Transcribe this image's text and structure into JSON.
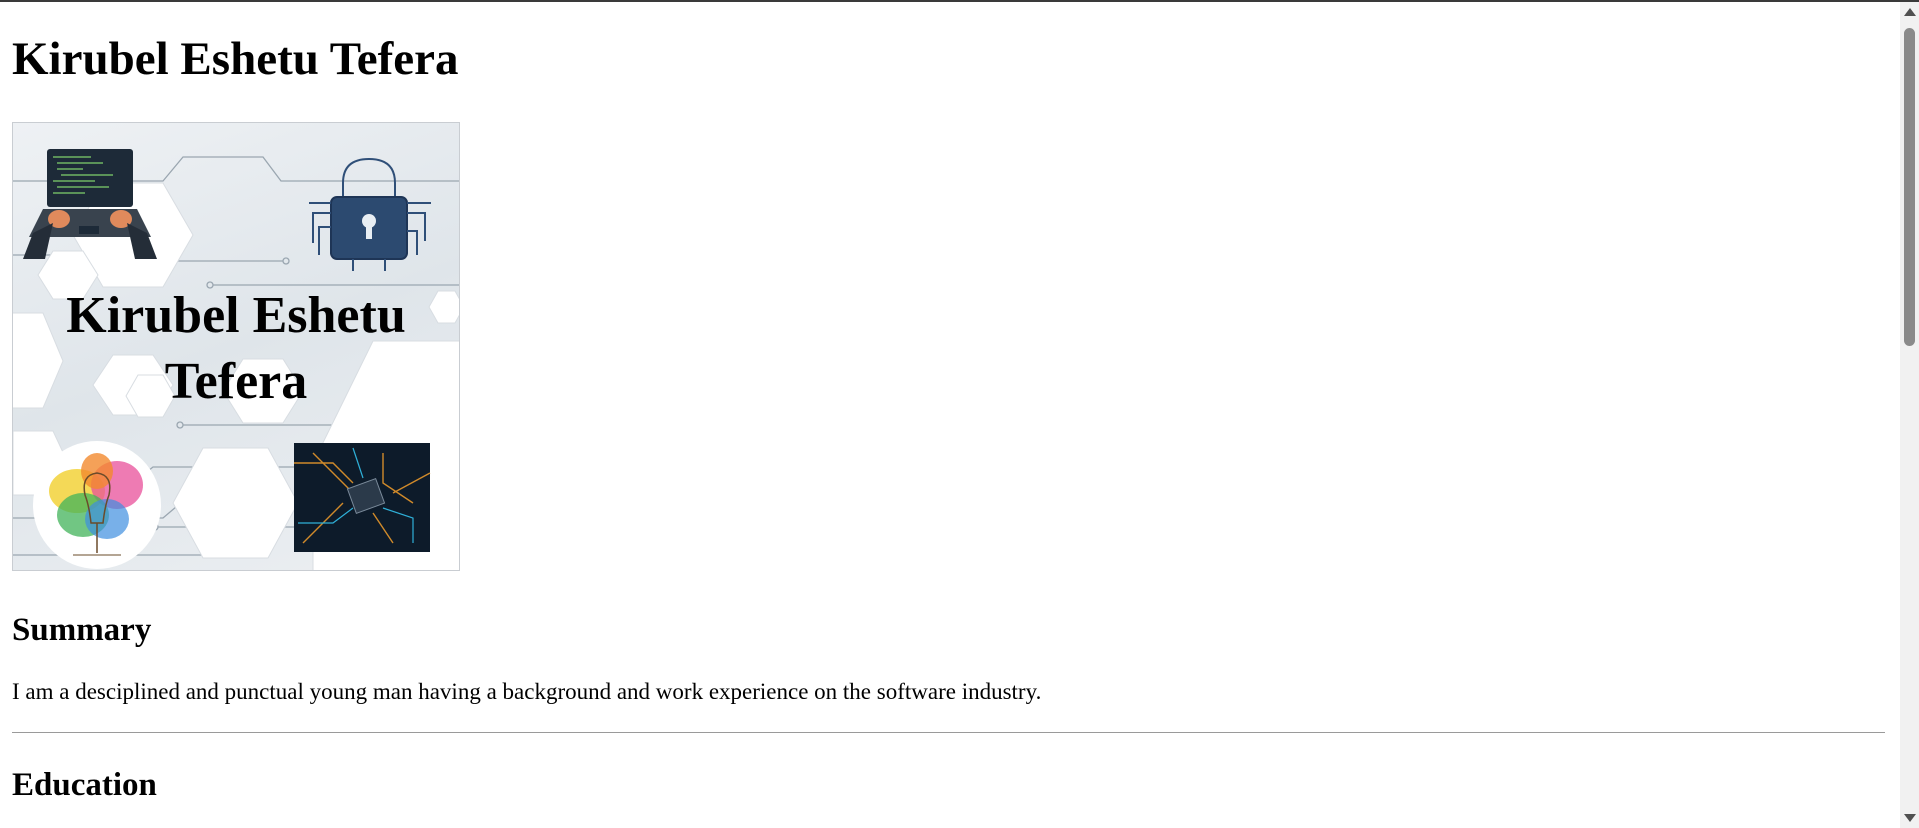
{
  "page": {
    "title": "Kirubel Eshetu Tefera",
    "banner": {
      "title_line1": "Kirubel Eshetu",
      "title_line2": "Tefera",
      "images": [
        "laptop-coding-icon",
        "circuit-padlock-icon",
        "colorful-lightbulb-icon",
        "circuit-board-chip-image"
      ]
    },
    "summary": {
      "heading": "Summary",
      "text": "I am a desciplined and punctual young man having a background and work experience on the software industry."
    },
    "education": {
      "heading": "Education"
    }
  }
}
